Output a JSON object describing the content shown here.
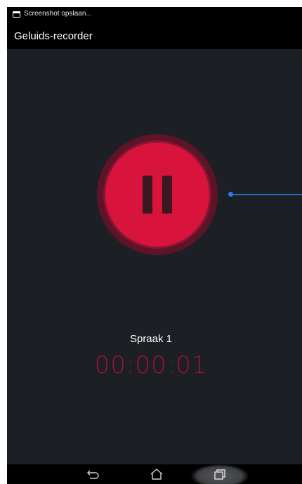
{
  "status_bar": {
    "notification_icon": "screenshot-icon",
    "notification_text": "Screenshot opslaan..."
  },
  "app_bar": {
    "title": "Geluids-recorder"
  },
  "recorder": {
    "control_icon": "pause-icon",
    "recording_name": "Spraak 1",
    "elapsed_time": "00:00:01"
  },
  "nav_bar": {
    "back_icon": "back-icon",
    "home_icon": "home-icon",
    "recents_icon": "recents-icon"
  },
  "colors": {
    "background": "#1c1f24",
    "accent_red": "#d9143c",
    "timer_red": "#a0122e",
    "marker_blue": "#1f6fc5"
  }
}
